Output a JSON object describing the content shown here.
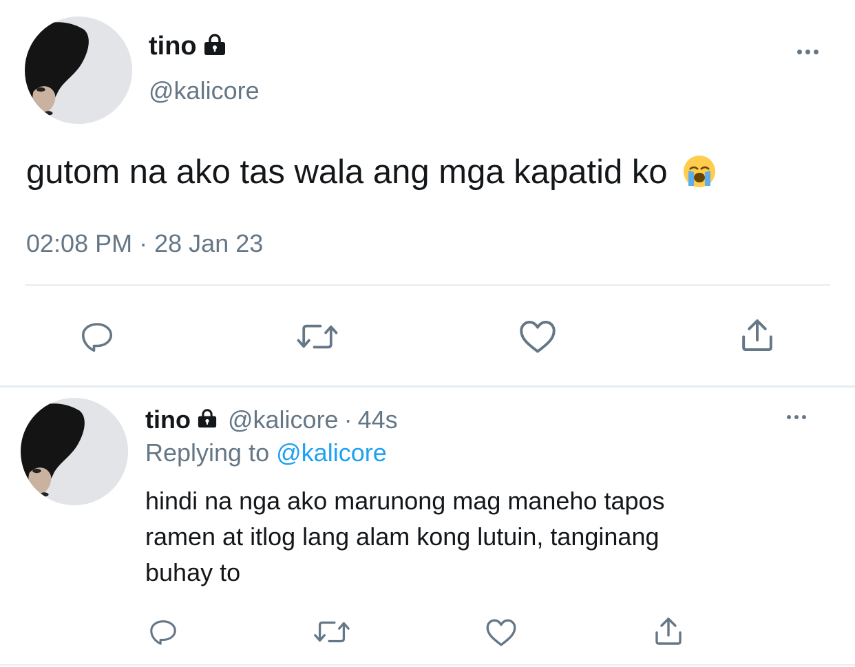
{
  "main_tweet": {
    "display_name": "tino",
    "handle": "@kalicore",
    "text": "gutom na ako tas wala ang mga kapatid ko",
    "emoji": "😭",
    "time": "02:08 PM",
    "separator": "·",
    "date": "28 Jan 23",
    "actions": [
      "reply-icon",
      "retweet-icon",
      "like-icon",
      "share-icon"
    ]
  },
  "reply_tweet": {
    "display_name": "tino",
    "handle": "@kalicore",
    "separator": "·",
    "age": "44s",
    "replying_prefix": "Replying to",
    "replying_handle": "@kalicore",
    "text_lines": [
      "hindi na nga ako marunong mag maneho tapos",
      "ramen at itlog lang alam kong lutuin, tanginang",
      "buhay to"
    ],
    "actions": [
      "reply-icon",
      "retweet-icon",
      "like-icon",
      "share-icon"
    ]
  },
  "colors": {
    "text": "#14171a",
    "muted": "#657786",
    "link": "#1da1f2",
    "divider": "#e6ecf0"
  }
}
